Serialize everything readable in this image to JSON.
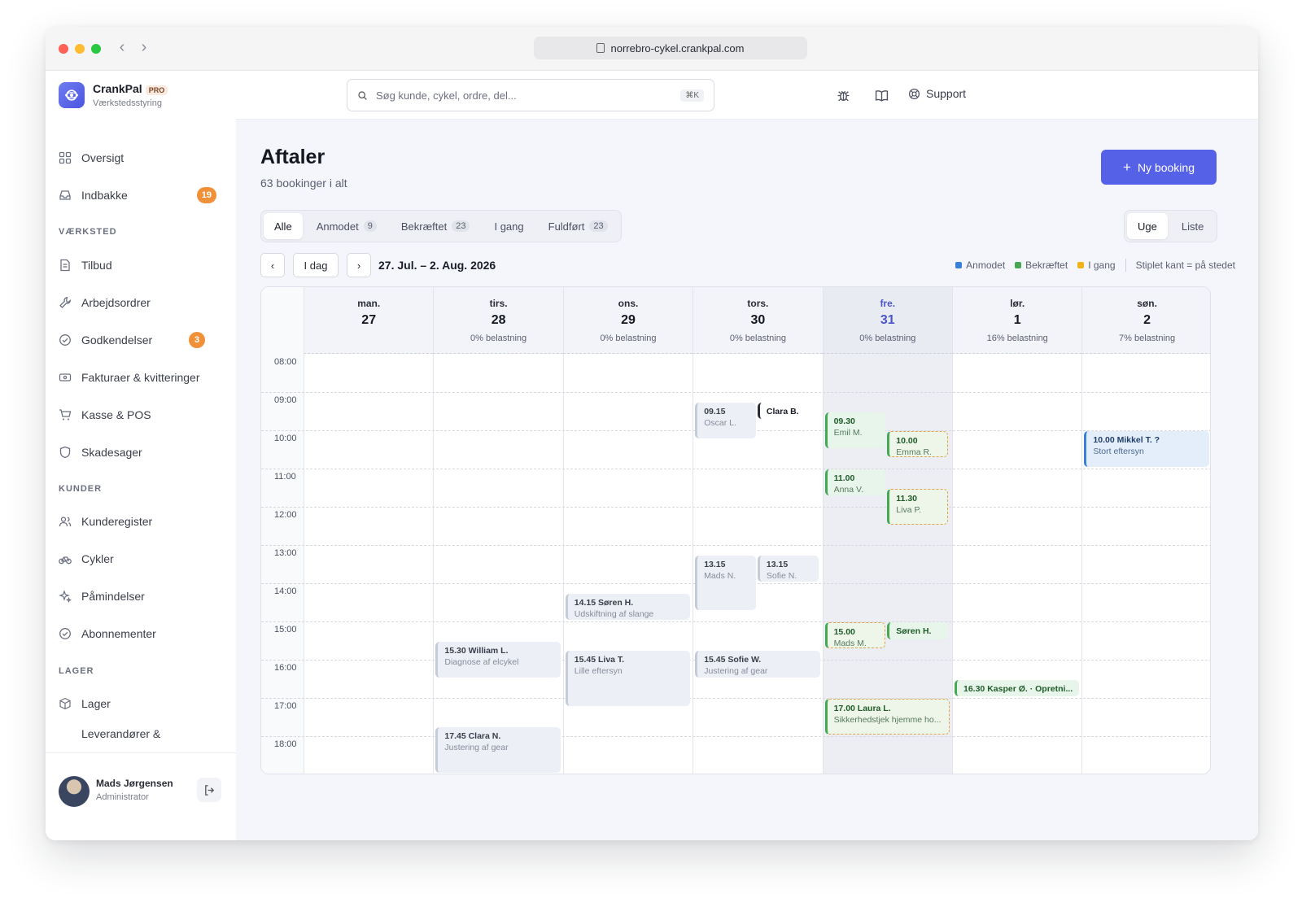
{
  "browser": {
    "url": "norrebro-cykel.crankpal.com"
  },
  "brand": {
    "name": "CrankPal",
    "badge": "PRO",
    "subtitle": "Værkstedsstyring"
  },
  "search": {
    "placeholder": "Søg kunde, cykel, ordre, del...",
    "shortcut": "⌘K"
  },
  "topbar": {
    "support_label": "Support"
  },
  "sidebar": {
    "items_top": [
      {
        "label": "Oversigt",
        "icon": "grid-icon"
      },
      {
        "label": "Indbakke",
        "icon": "inbox-icon",
        "badge": "19"
      }
    ],
    "sections": [
      {
        "title": "VÆRKSTED",
        "items": [
          {
            "label": "Tilbud",
            "icon": "document-icon"
          },
          {
            "label": "Arbejdsordrer",
            "icon": "wrench-icon"
          },
          {
            "label": "Godkendelser",
            "icon": "check-circle-icon",
            "badge": "3"
          },
          {
            "label": "Fakturaer & kvitteringer",
            "icon": "banknote-icon"
          },
          {
            "label": "Kasse & POS",
            "icon": "cart-icon"
          },
          {
            "label": "Skadesager",
            "icon": "shield-icon"
          }
        ]
      },
      {
        "title": "KUNDER",
        "items": [
          {
            "label": "Kunderegister",
            "icon": "users-icon"
          },
          {
            "label": "Cykler",
            "icon": "bike-icon"
          },
          {
            "label": "Påmindelser",
            "icon": "sparkle-icon"
          },
          {
            "label": "Abonnementer",
            "icon": "check-circle-icon"
          }
        ]
      },
      {
        "title": "LAGER",
        "items": [
          {
            "label": "Lager",
            "icon": "box-icon"
          },
          {
            "label": "Leverandører &",
            "icon": "truck-icon"
          }
        ]
      }
    ],
    "user": {
      "name": "Mads Jørgensen",
      "role": "Administrator"
    }
  },
  "page": {
    "title": "Aftaler",
    "subtitle": "63 bookinger i alt",
    "new_button": "Ny booking",
    "filters": [
      {
        "label": "Alle",
        "active": true
      },
      {
        "label": "Anmodet",
        "count": "9"
      },
      {
        "label": "Bekræftet",
        "count": "23"
      },
      {
        "label": "I gang"
      },
      {
        "label": "Fuldført",
        "count": "23"
      }
    ],
    "views": [
      {
        "label": "Uge",
        "active": true
      },
      {
        "label": "Liste"
      }
    ],
    "nav": {
      "prev": "‹",
      "today": "I dag",
      "next": "›",
      "range": "27. Jul. – 2. Aug. 2026"
    },
    "legend": [
      {
        "label": "Anmodet",
        "color": "#3a7fd8"
      },
      {
        "label": "Bekræftet",
        "color": "#45a954"
      },
      {
        "label": "I gang",
        "color": "#f2b21b"
      }
    ],
    "legend_note": "Stiplet kant = på stedet"
  },
  "calendar": {
    "hours": [
      "08:00",
      "09:00",
      "10:00",
      "11:00",
      "12:00",
      "13:00",
      "14:00",
      "15:00",
      "16:00",
      "17:00",
      "18:00"
    ],
    "days": [
      {
        "name": "man.",
        "num": "27",
        "load": ""
      },
      {
        "name": "tirs.",
        "num": "28",
        "load": "0% belastning"
      },
      {
        "name": "ons.",
        "num": "29",
        "load": "0% belastning"
      },
      {
        "name": "tors.",
        "num": "30",
        "load": "0% belastning"
      },
      {
        "name": "fre.",
        "num": "31",
        "load": "0% belastning",
        "today": true
      },
      {
        "name": "lør.",
        "num": "1",
        "load": "16% belastning"
      },
      {
        "name": "søn.",
        "num": "2",
        "load": "7% belastning"
      }
    ],
    "events": [
      {
        "day": 3,
        "start": "09:15",
        "end": "10:15",
        "lane": 0,
        "lanes": 2,
        "style": "grey",
        "title": "09.15",
        "sub": "Oscar L."
      },
      {
        "day": 3,
        "start": "09:15",
        "end": "09:45",
        "lane": 1,
        "lanes": 2,
        "style": "plain",
        "title": "Clara B.",
        "sub": ""
      },
      {
        "day": 4,
        "start": "09:30",
        "end": "10:30",
        "lane": 0,
        "lanes": 2,
        "style": "green",
        "title": "09.30",
        "sub": "Emil M."
      },
      {
        "day": 4,
        "start": "10:00",
        "end": "10:45",
        "lane": 1,
        "lanes": 2,
        "style": "greendash",
        "title": "10.00",
        "sub": "Emma R."
      },
      {
        "day": 6,
        "start": "10:00",
        "end": "11:00",
        "lane": 0,
        "lanes": 1,
        "style": "blue",
        "title": "10.00 Mikkel T. ?",
        "sub": "Stort eftersyn"
      },
      {
        "day": 4,
        "start": "11:00",
        "end": "11:45",
        "lane": 0,
        "lanes": 2,
        "style": "green",
        "title": "11.00",
        "sub": "Anna V."
      },
      {
        "day": 4,
        "start": "11:30",
        "end": "12:30",
        "lane": 1,
        "lanes": 2,
        "style": "greendash",
        "title": "11.30",
        "sub": "Liva P."
      },
      {
        "day": 3,
        "start": "13:15",
        "end": "14:45",
        "lane": 0,
        "lanes": 2,
        "style": "grey",
        "title": "13.15",
        "sub": "Mads N."
      },
      {
        "day": 3,
        "start": "13:15",
        "end": "14:00",
        "lane": 1,
        "lanes": 2,
        "style": "grey",
        "title": "13.15",
        "sub": "Sofie N."
      },
      {
        "day": 2,
        "start": "14:15",
        "end": "15:00",
        "lane": 0,
        "lanes": 1,
        "style": "grey",
        "title": "14.15 Søren H.",
        "sub": "Udskiftning af slange"
      },
      {
        "day": 4,
        "start": "15:00",
        "end": "15:45",
        "lane": 0,
        "lanes": 2,
        "style": "greendash",
        "title": "15.00",
        "sub": "Mads M."
      },
      {
        "day": 4,
        "start": "15:00",
        "end": "15:30",
        "lane": 1,
        "lanes": 2,
        "style": "green",
        "title": "Søren H.",
        "sub": ""
      },
      {
        "day": 1,
        "start": "15:30",
        "end": "16:30",
        "lane": 0,
        "lanes": 1,
        "style": "grey",
        "title": "15.30 William L.",
        "sub": "Diagnose af elcykel"
      },
      {
        "day": 2,
        "start": "15:45",
        "end": "17:15",
        "lane": 0,
        "lanes": 1,
        "style": "grey",
        "title": "15.45 Liva T.",
        "sub": "Lille eftersyn"
      },
      {
        "day": 3,
        "start": "15:45",
        "end": "16:30",
        "lane": 0,
        "lanes": 1,
        "style": "grey",
        "title": "15.45 Sofie W.",
        "sub": "Justering af gear"
      },
      {
        "day": 5,
        "start": "16:30",
        "end": "17:00",
        "lane": 0,
        "lanes": 1,
        "style": "green",
        "title": "16.30 Kasper Ø. · Opretni...",
        "sub": ""
      },
      {
        "day": 4,
        "start": "17:00",
        "end": "18:00",
        "lane": 0,
        "lanes": 1,
        "style": "greendash",
        "title": "17.00 Laura L.",
        "sub": "Sikkerhedstjek hjemme ho..."
      },
      {
        "day": 1,
        "start": "17:45",
        "end": "19:00",
        "lane": 0,
        "lanes": 1,
        "style": "grey",
        "title": "17.45 Clara N.",
        "sub": "Justering af gear"
      }
    ]
  }
}
